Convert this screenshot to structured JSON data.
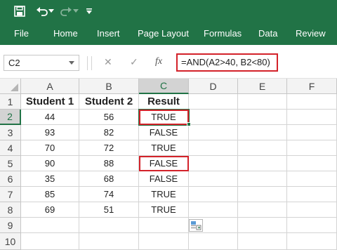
{
  "quick_access": {
    "icons": [
      "save-icon",
      "undo-icon",
      "undo-dropdown-icon",
      "redo-icon",
      "redo-dropdown-icon",
      "customize-icon"
    ]
  },
  "ribbon": {
    "tabs": [
      "File",
      "Home",
      "Insert",
      "Page Layout",
      "Formulas",
      "Data",
      "Review"
    ]
  },
  "formula_bar": {
    "name_box": "C2",
    "cancel_glyph": "✕",
    "enter_glyph": "✓",
    "fx_label": "fx",
    "formula": "=AND(A2>40, B2<80)"
  },
  "sheet": {
    "column_headers": [
      "A",
      "B",
      "C",
      "D",
      "E",
      "F"
    ],
    "row_headers": [
      "1",
      "2",
      "3",
      "4",
      "5",
      "6",
      "7",
      "8",
      "9",
      "10"
    ],
    "header_row": [
      "Student 1",
      "Student 2",
      "Result"
    ],
    "rows": [
      [
        "44",
        "56",
        "TRUE"
      ],
      [
        "93",
        "82",
        "FALSE"
      ],
      [
        "70",
        "72",
        "TRUE"
      ],
      [
        "90",
        "88",
        "FALSE"
      ],
      [
        "35",
        "68",
        "FALSE"
      ],
      [
        "85",
        "74",
        "TRUE"
      ],
      [
        "69",
        "51",
        "TRUE"
      ]
    ],
    "active_cell": "C2",
    "highlighted_cells": [
      "C2",
      "C5"
    ]
  },
  "colors": {
    "ribbon_green": "#217346",
    "highlight_red": "#d3222a"
  }
}
